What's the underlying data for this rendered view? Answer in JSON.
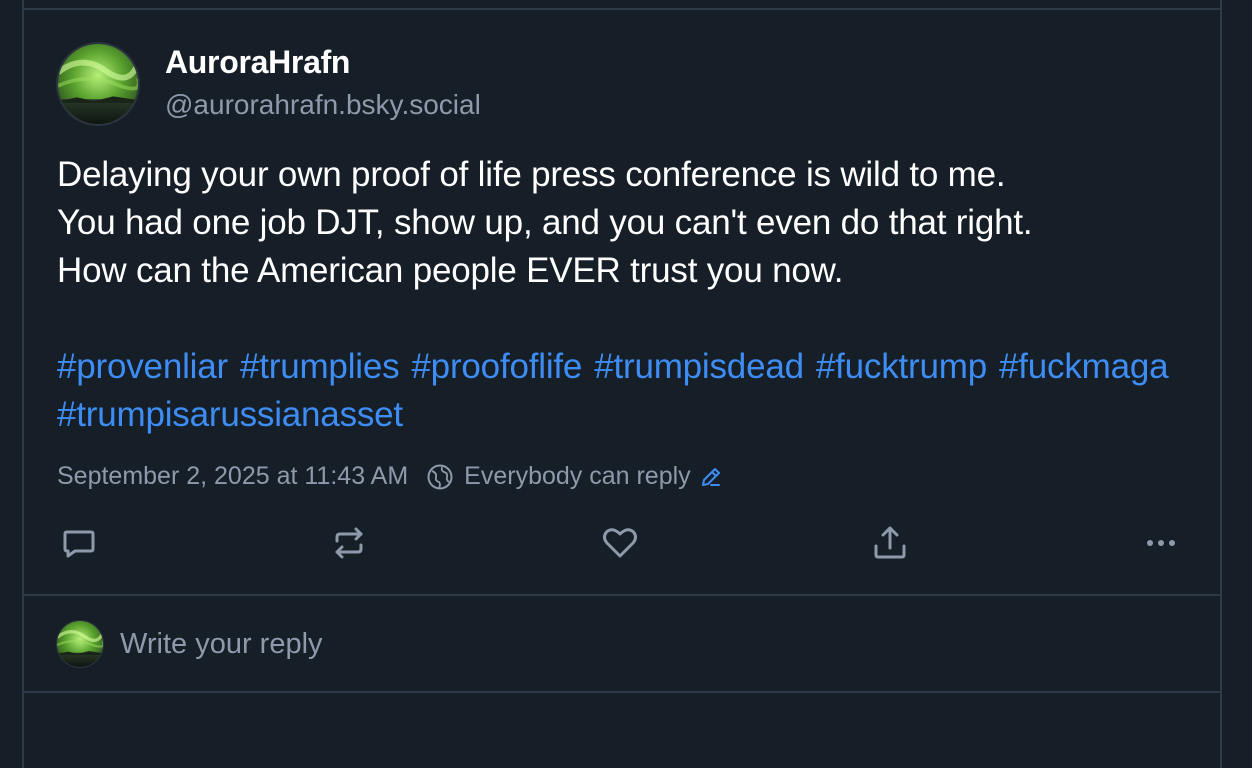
{
  "post": {
    "author": {
      "display_name": "AuroraHrafn",
      "handle": "@aurorahrafn.bsky.social"
    },
    "text_lines": [
      "Delaying your own proof of life press conference is wild to me.",
      "You had one job DJT, show up, and you can't even do that right.",
      "How can the American people EVER trust you now."
    ],
    "hashtags": [
      "#provenliar",
      "#trumplies",
      "#proofoflife",
      "#trumpisdead",
      "#fucktrump",
      "#fuckmaga",
      "#trumpisarussianasset"
    ],
    "timestamp": "September 2, 2025 at 11:43 AM",
    "reply_setting": "Everybody can reply"
  },
  "actions": {
    "icons": [
      "reply-icon",
      "repost-icon",
      "like-icon",
      "share-icon",
      "more-icon"
    ]
  },
  "reply_box": {
    "placeholder": "Write your reply"
  },
  "colors": {
    "background": "#161e27",
    "border": "#2e3a48",
    "text_primary": "#ffffff",
    "text_secondary": "#8e9aab",
    "link": "#3d8df5"
  }
}
